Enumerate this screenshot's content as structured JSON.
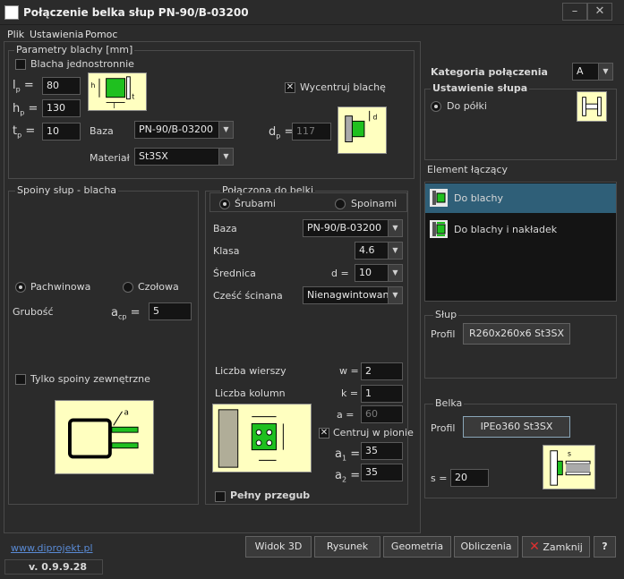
{
  "window": {
    "title": "Połączenie belka słup  PN-90/B-03200"
  },
  "menu": [
    "Plik",
    "Ustawienia",
    "Pomoc"
  ],
  "plate": {
    "group_title": "Parametry blachy [mm]",
    "one_sided_label": "Blacha jednostronnie",
    "one_sided_checked": false,
    "lp_value": "80",
    "hp_value": "130",
    "tp_value": "10",
    "base_label": "Baza",
    "base_value": "PN-90/B-03200",
    "material_label": "Materiał",
    "material_value": "St3SX",
    "center_label": "Wycentruj blachę",
    "center_checked": true,
    "dp_value": "117"
  },
  "welds": {
    "group_title": "Spoiny słup - blacha",
    "fillet_label": "Pachwinowa",
    "butt_label": "Czołowa",
    "thickness_label": "Grubość",
    "acp_value": "5",
    "outer_only_label": "Tylko spoiny zewnętrzne"
  },
  "bolts": {
    "group_title": "Połączona do belki",
    "bolts_label": "Śrubami",
    "welds_label": "Spoinami",
    "base_label": "Baza",
    "base_value": "PN-90/B-03200",
    "class_label": "Klasa",
    "class_value": "4.6",
    "diameter_label": "Średnica",
    "d_label": "d =",
    "diameter_value": "10",
    "shear_label": "Cześć ścinana",
    "shear_value": "Nienagwintowana",
    "rows_label": "Liczba wierszy",
    "w_label": "w =",
    "rows_value": "2",
    "cols_label": "Liczba kolumn",
    "k_label": "k =",
    "cols_value": "1",
    "a_label": "a =",
    "a_value": "60",
    "center_vertical_label": "Centruj w pionie",
    "center_vertical_checked": true,
    "a1_value": "35",
    "a2_value": "35",
    "full_hinge_label": "Pełny przegub"
  },
  "category": {
    "label": "Kategoria połączenia",
    "value": "A"
  },
  "column_setting": {
    "title": "Ustawienie słupa",
    "option": "Do półki"
  },
  "connector": {
    "title": "Element łączący",
    "items": [
      "Do blachy",
      "Do blachy i nakładek"
    ],
    "selected_index": 0
  },
  "column_group": {
    "title": "Słup",
    "profile_label": "Profil",
    "profile_value": "R260x260x6 St3SX"
  },
  "beam_group": {
    "title": "Belka",
    "profile_label": "Profil",
    "profile_value": "IPEo360 St3SX",
    "s_label": "s =",
    "s_value": "20"
  },
  "footer": {
    "link": "www.diprojekt.pl",
    "version": "v. 0.9.9.28",
    "buttons": {
      "view3d": "Widok 3D",
      "drawing": "Rysunek",
      "geometry": "Geometria",
      "calc": "Obliczenia",
      "close": "Zamknij",
      "help": "?"
    }
  },
  "colors": {
    "background": "#2b2b2b",
    "input_bg": "#141414",
    "selection": "#2f5f78",
    "image_bg": "#ffffc0",
    "link": "#5a8bd6",
    "close_icon": "#e03030"
  }
}
